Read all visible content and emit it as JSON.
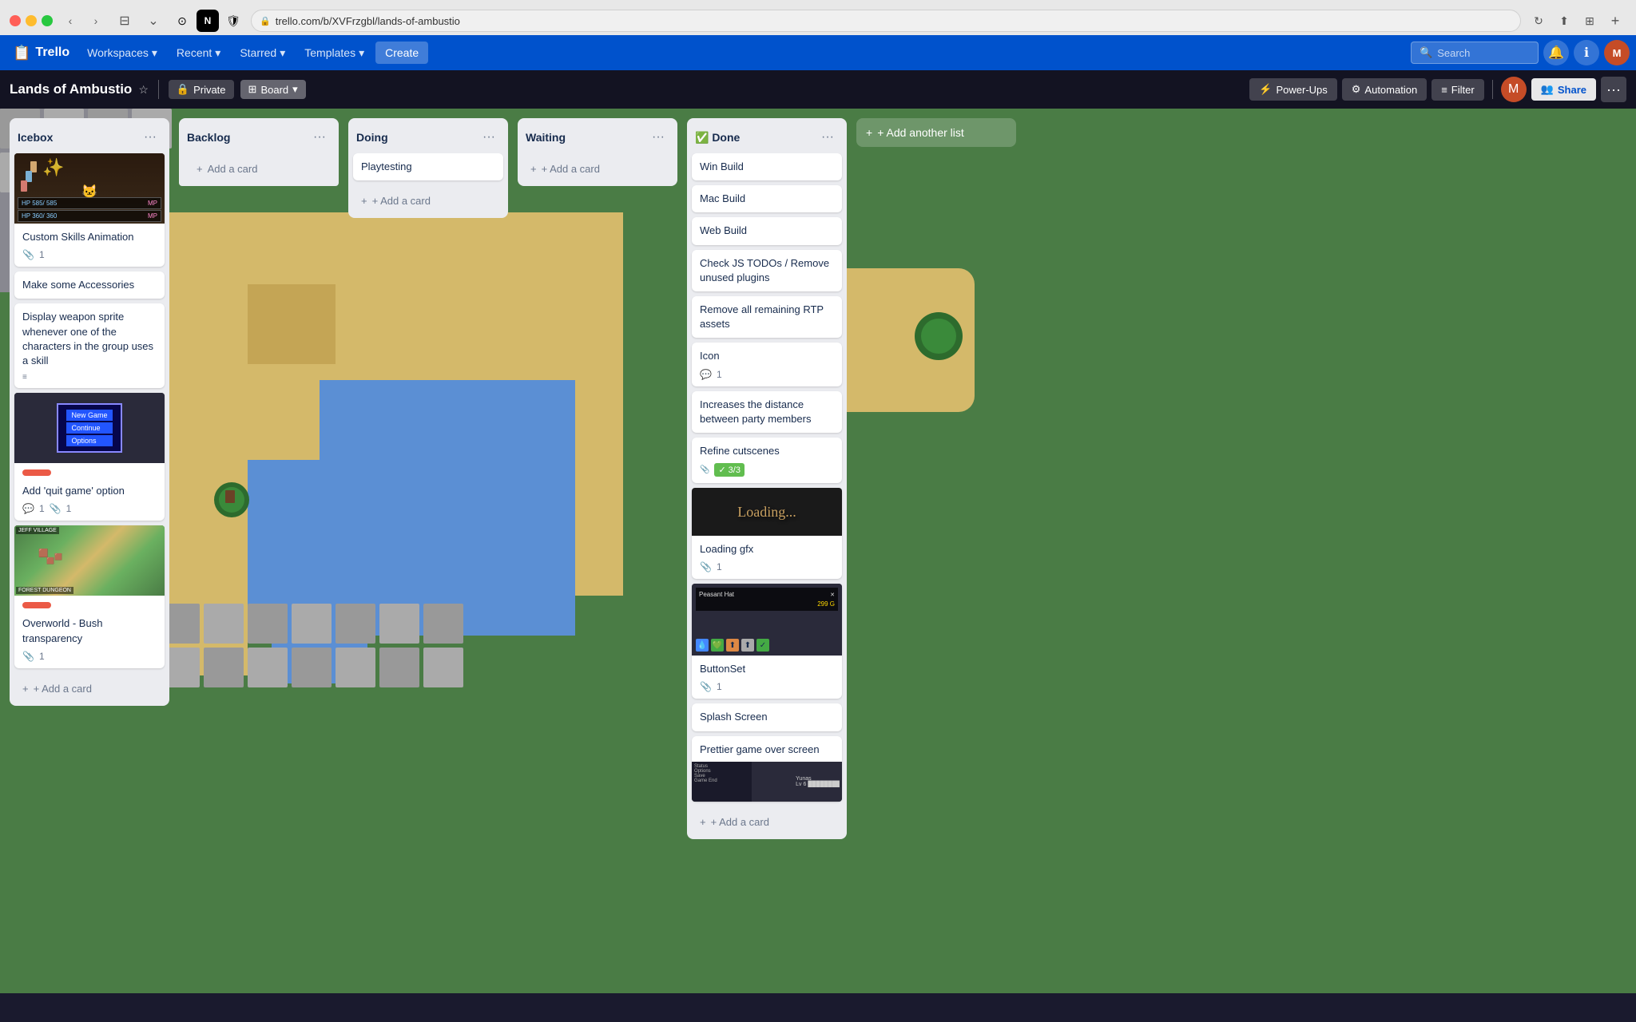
{
  "browser": {
    "url": "trello.com/b/XVFrzgbl/lands-of-ambustio",
    "url_display": "trello.com/b/XVFrzgbl/lands-of-ambustio",
    "tab_title": "Lands of Ambustio",
    "back_btn": "‹",
    "forward_btn": "›",
    "reload_btn": "↻",
    "share_btn": "↑",
    "tabs_btn": "⊞"
  },
  "trello_nav": {
    "logo": "Trello",
    "workspaces": "Workspaces",
    "recent": "Recent",
    "starred": "Starred",
    "templates": "Templates",
    "create": "Create",
    "search_placeholder": "Search"
  },
  "board": {
    "title": "Lands of Ambustio",
    "visibility": "Private",
    "view": "Board",
    "power_ups": "Power-Ups",
    "automation": "Automation",
    "filter": "Filter",
    "share": "Share",
    "add_list": "+ Add another list"
  },
  "lists": {
    "icebox": {
      "title": "Icebox",
      "cards": [
        {
          "id": "custom-skills",
          "has_image": true,
          "image_type": "game-screenshot",
          "labels": [],
          "text": "Custom Skills Animation",
          "attachment_count": 1
        },
        {
          "id": "accessories",
          "text": "Make some Accessories",
          "labels": [],
          "attachment_count": 0
        },
        {
          "id": "weapon-sprite",
          "text": "Display weapon sprite whenever one of the characters in the group uses a skill",
          "labels": [],
          "attachment_count": 0,
          "has_attachment_icon": true
        },
        {
          "id": "quit-game",
          "has_image": true,
          "image_type": "menu-screenshot",
          "labels": [
            "red"
          ],
          "text": "Add 'quit game' option",
          "attachment_count": 1,
          "comment_count": 1
        },
        {
          "id": "overworld",
          "has_image": true,
          "image_type": "overworld-screenshot",
          "labels": [
            "red"
          ],
          "text": "Overworld - Bush transparency",
          "attachment_count": 1
        }
      ],
      "add_card": "+ Add a card"
    },
    "backlog": {
      "title": "Backlog",
      "cards": [],
      "add_card": "+ Add a card"
    },
    "doing": {
      "title": "Doing",
      "cards": [
        {
          "id": "playtesting",
          "text": "Playtesting",
          "labels": []
        }
      ],
      "add_card": "+ Add a card"
    },
    "waiting": {
      "title": "Waiting",
      "cards": [],
      "add_card": "+ Add a card"
    },
    "done": {
      "title": "✅ Done",
      "cards": [
        {
          "id": "win-build",
          "text": "Win Build"
        },
        {
          "id": "mac-build",
          "text": "Mac Build"
        },
        {
          "id": "web-build",
          "text": "Web Build"
        },
        {
          "id": "check-js",
          "text": "Check JS TODOs / Remove unused plugins"
        },
        {
          "id": "remove-rtp",
          "text": "Remove all remaining RTP assets"
        },
        {
          "id": "icon",
          "text": "Icon",
          "comment_count": 1
        },
        {
          "id": "distance",
          "text": "Increases the distance between party members"
        },
        {
          "id": "refine-cutscenes",
          "text": "Refine cutscenes",
          "badge": "3/3",
          "has_checklist": true
        },
        {
          "id": "loading-gfx",
          "text": "Loading gfx",
          "has_image": true,
          "image_type": "loading-screenshot",
          "attachment_count": 1
        },
        {
          "id": "buttonset",
          "text": "ButtonSet",
          "has_image": true,
          "image_type": "buttonset-screenshot",
          "attachment_count": 1
        },
        {
          "id": "splash-screen",
          "text": "Splash Screen"
        },
        {
          "id": "game-over",
          "text": "Prettier game over screen",
          "has_image": true,
          "image_type": "gameover-screenshot"
        }
      ],
      "add_card": "+ Add a card"
    }
  }
}
